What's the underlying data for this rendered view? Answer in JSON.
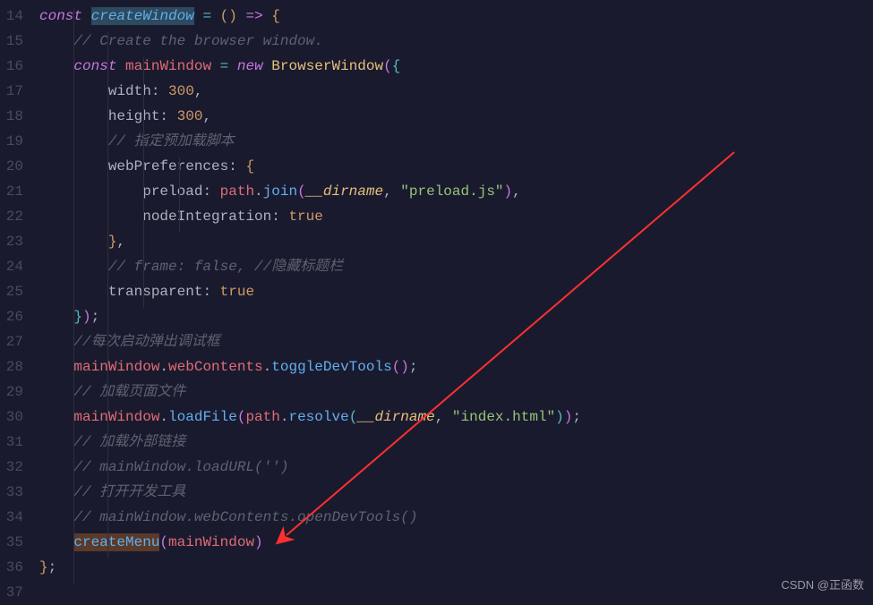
{
  "lineNumbers": [
    "14",
    "15",
    "16",
    "17",
    "18",
    "19",
    "20",
    "21",
    "22",
    "23",
    "24",
    "25",
    "26",
    "27",
    "28",
    "29",
    "30",
    "31",
    "32",
    "33",
    "34",
    "35",
    "36",
    "37"
  ],
  "code": {
    "l14": {
      "kw1": "const",
      "fn": "createWindow",
      "op": " = ",
      "paren1": "()",
      "arrow": " => ",
      "brace": "{"
    },
    "l15": {
      "indent": "    ",
      "comment": "// Create the browser window."
    },
    "l16": {
      "indent": "    ",
      "kw1": "const",
      "sp": " ",
      "var": "mainWindow",
      "op": " = ",
      "kw2": "new",
      "sp2": " ",
      "class": "BrowserWindow",
      "p1": "(",
      "p2": "{"
    },
    "l17": {
      "indent": "        ",
      "prop": "width",
      "colon": ": ",
      "num": "300",
      "comma": ","
    },
    "l18": {
      "indent": "        ",
      "prop": "height",
      "colon": ": ",
      "num": "300",
      "comma": ","
    },
    "l19": {
      "indent": "        ",
      "comment": "// 指定预加载脚本"
    },
    "l20": {
      "indent": "        ",
      "prop": "webPreferences",
      "colon": ": ",
      "brace": "{"
    },
    "l21": {
      "indent": "            ",
      "prop": "preload",
      "colon": ": ",
      "obj": "path",
      "dot": ".",
      "fn": "join",
      "p1": "(",
      "builtin": "__dirname",
      "comma": ", ",
      "str": "\"preload.js\"",
      "p2": ")",
      "comma2": ","
    },
    "l22": {
      "indent": "            ",
      "prop": "nodeIntegration",
      "colon": ": ",
      "bool": "true"
    },
    "l23": {
      "indent": "        ",
      "brace": "}",
      "comma": ","
    },
    "l24": {
      "indent": "        ",
      "comment": "// frame: false, //隐藏标题栏"
    },
    "l25": {
      "indent": "        ",
      "prop": "transparent",
      "colon": ": ",
      "bool": "true"
    },
    "l26": {
      "indent": "    ",
      "p1": "}",
      "p2": ")",
      "semi": ";"
    },
    "l27": {
      "indent": "    ",
      "comment": "//每次启动弹出调试框"
    },
    "l28": {
      "indent": "    ",
      "var": "mainWindow",
      "dot1": ".",
      "prop": "webContents",
      "dot2": ".",
      "fn": "toggleDevTools",
      "p1": "(",
      "p2": ")",
      "semi": ";"
    },
    "l29": {
      "indent": "    ",
      "comment": "// 加载页面文件"
    },
    "l30": {
      "indent": "    ",
      "var": "mainWindow",
      "dot1": ".",
      "fn": "loadFile",
      "p1": "(",
      "obj": "path",
      "dot2": ".",
      "fn2": "resolve",
      "p2": "(",
      "builtin": "__dirname",
      "comma": ", ",
      "str": "\"index.html\"",
      "p3": ")",
      "p4": ")",
      "semi": ";"
    },
    "l31": {
      "indent": "    ",
      "comment": "// 加载外部链接"
    },
    "l32": {
      "indent": "    ",
      "comment": "// mainWindow.loadURL('')"
    },
    "l33": {
      "indent": "    ",
      "comment": "// 打开开发工具"
    },
    "l34": {
      "indent": "    ",
      "comment": "// mainWindow.webContents.openDevTools()"
    },
    "l35": {
      "indent": "    ",
      "fn": "createMenu",
      "p1": "(",
      "arg": "mainWindow",
      "p2": ")"
    },
    "l36": {
      "brace": "}",
      "semi": ";"
    },
    "l37": {
      "text": ""
    }
  },
  "watermark": "CSDN @正函数"
}
